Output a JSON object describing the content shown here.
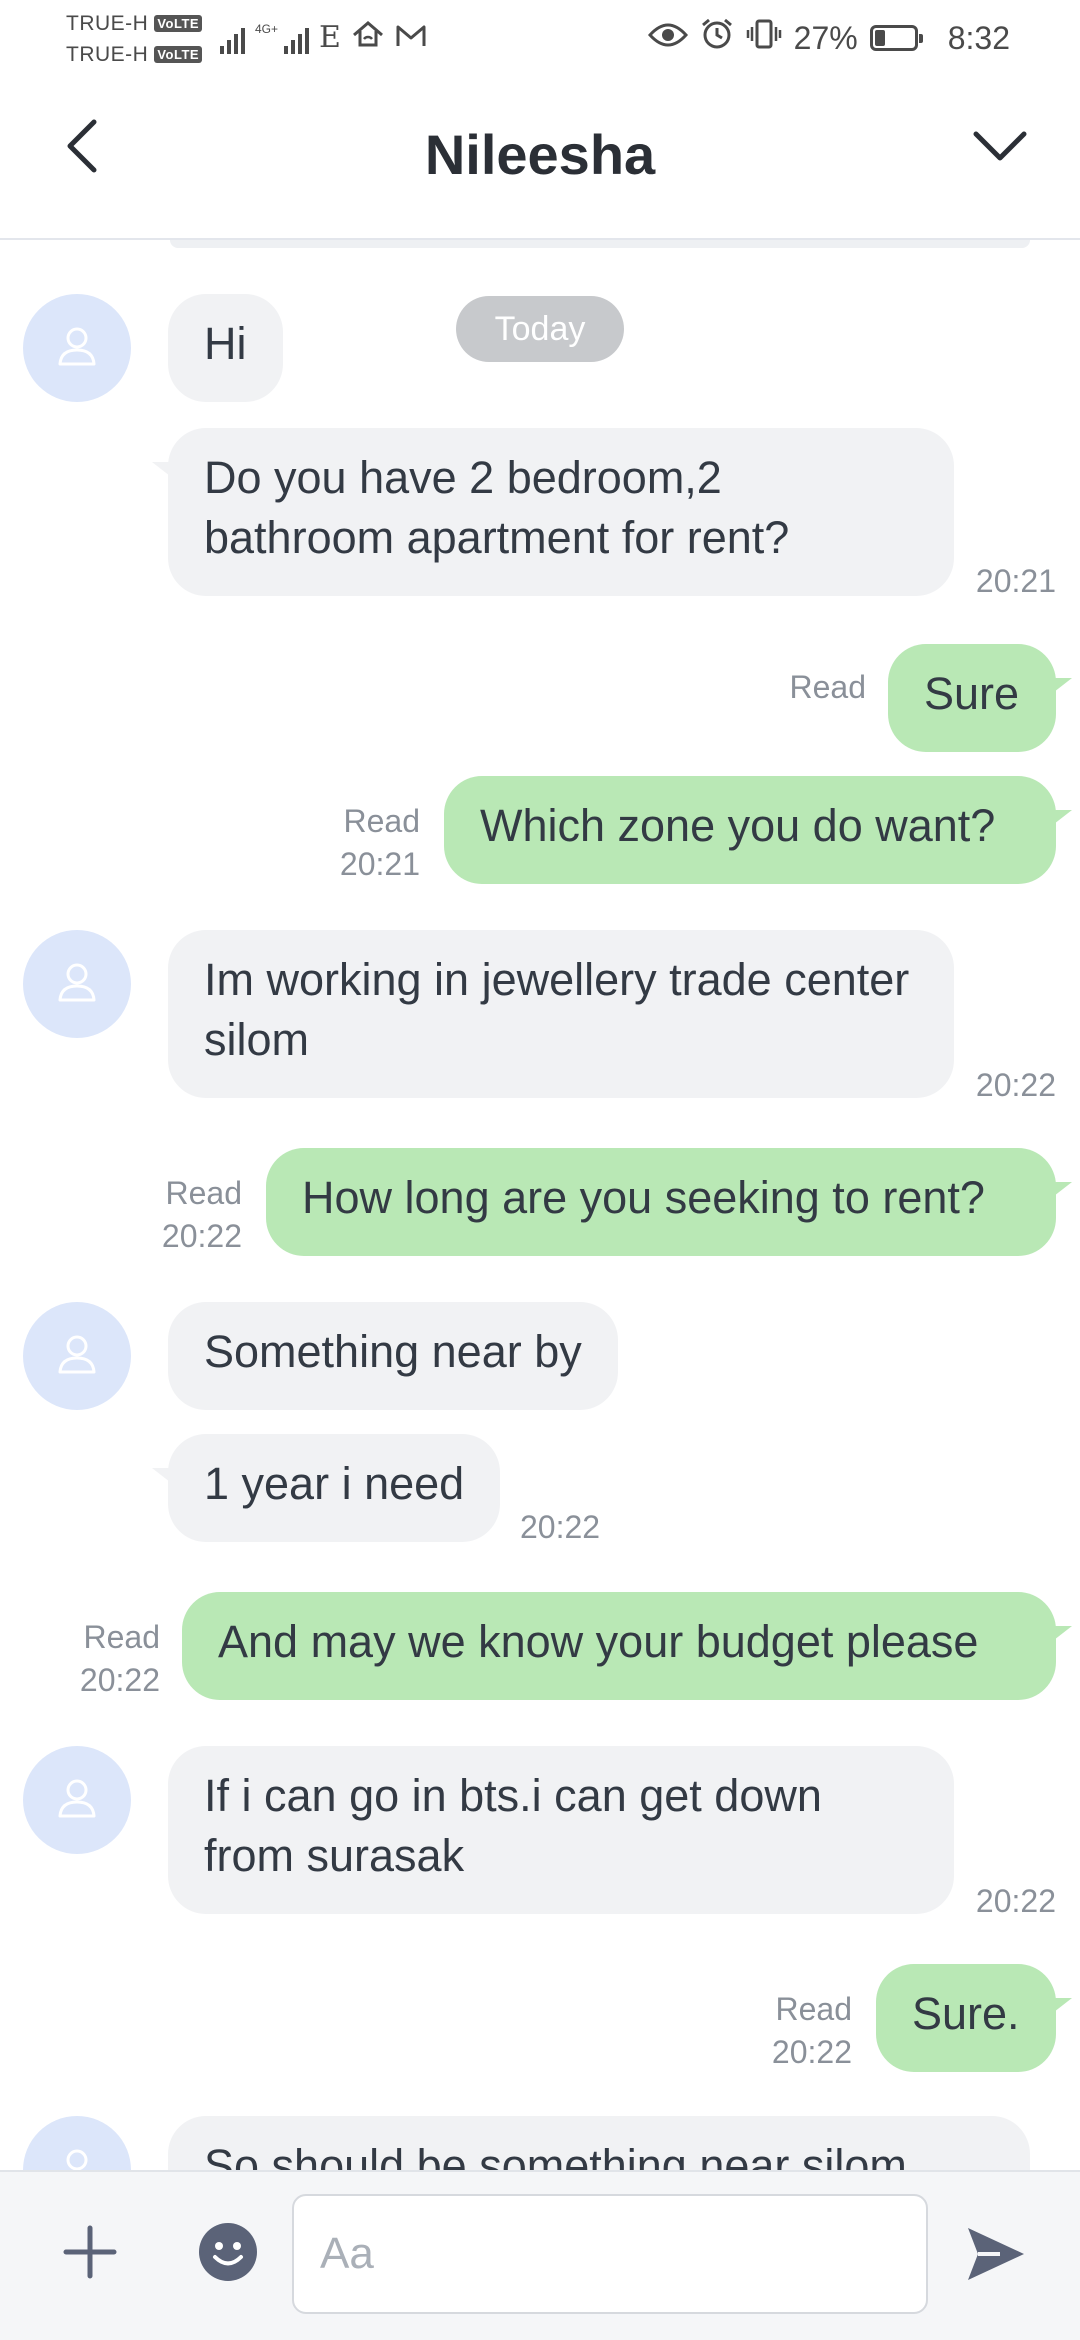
{
  "status_bar": {
    "carrier_1": "TRUE-H",
    "carrier_2": "TRUE-H",
    "volte_badge": "VoLTE",
    "net_label": "4G+",
    "edge_label": "E",
    "battery_percent": "27%",
    "battery_level": 0.27,
    "time": "8:32"
  },
  "header": {
    "title": "Nileesha",
    "back_icon": "chevron-left-icon",
    "expand_icon": "chevron-down-icon"
  },
  "chat": {
    "day_separator": "Today",
    "messages": [
      {
        "direction": "in",
        "text": "Hi"
      },
      {
        "direction": "in",
        "text": "Do you have 2 bedroom,2 bathroom apartment for rent?",
        "time": "20:21"
      },
      {
        "direction": "out",
        "text": "Sure",
        "read": "Read"
      },
      {
        "direction": "out",
        "text": "Which zone you do want?",
        "read": "Read",
        "time": "20:21"
      },
      {
        "direction": "in",
        "text": "Im working in jewellery trade center silom",
        "time": "20:22"
      },
      {
        "direction": "out",
        "text": "How long are you seeking to rent?",
        "read": "Read",
        "time": "20:22"
      },
      {
        "direction": "in",
        "text": "Something near by"
      },
      {
        "direction": "in",
        "text": "1 year i need",
        "time": "20:22"
      },
      {
        "direction": "out",
        "text": "And may we know your budget please",
        "read": "Read",
        "time": "20:22"
      },
      {
        "direction": "in",
        "text": "If i can go in bts.i can get down from surasak",
        "time": "20:22"
      },
      {
        "direction": "out",
        "text": "Sure.",
        "read": "Read",
        "time": "20:22"
      },
      {
        "direction": "in",
        "text": "So should be something near silom"
      }
    ]
  },
  "composer": {
    "placeholder": "Aa",
    "plus_icon": "plus-icon",
    "emoji_icon": "emoji-icon",
    "send_icon": "send-icon"
  },
  "colors": {
    "incoming_bubble": "#f1f2f4",
    "outgoing_bubble": "#b9e8b5",
    "avatar_bg": "#dce6fa",
    "day_pill": "#c7c9cc",
    "icon": "#5b6378"
  }
}
